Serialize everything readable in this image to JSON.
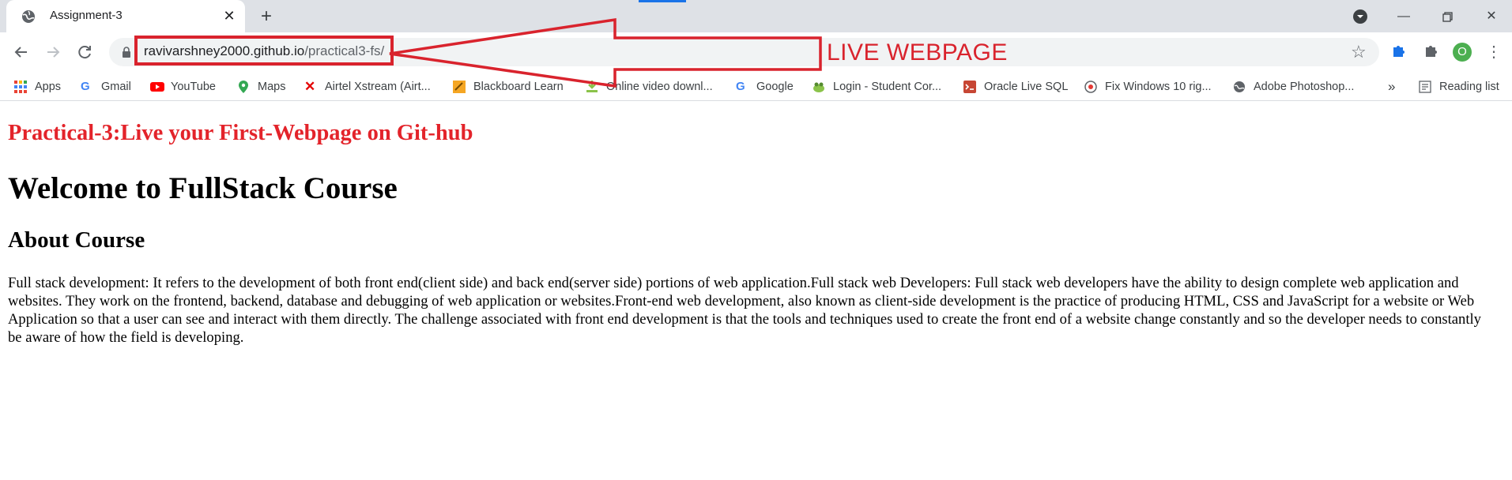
{
  "browser": {
    "tab": {
      "title": "Assignment-3",
      "favicon": "globe-icon"
    },
    "new_tab_icon": "plus-icon",
    "window_controls": [
      "profile-menu-icon",
      "minimize-icon",
      "restore-icon",
      "close-icon"
    ],
    "address": {
      "host": "ravivarshney2000.github.io",
      "path": "/practical3-fs/"
    },
    "annotation_label": "LIVE WEBPAGE",
    "extensions": [
      "puzzle-extension-icon",
      "extensions-icon"
    ],
    "profile_initial": "O",
    "bookmarks": [
      {
        "label": "Apps",
        "icon": "apps-grid-icon"
      },
      {
        "label": "Gmail",
        "icon": "google-icon"
      },
      {
        "label": "YouTube",
        "icon": "youtube-icon"
      },
      {
        "label": "Maps",
        "icon": "maps-pin-icon"
      },
      {
        "label": "Airtel Xstream (Airt...",
        "icon": "airtel-icon"
      },
      {
        "label": "Blackboard Learn",
        "icon": "blackboard-icon"
      },
      {
        "label": "Online video downl...",
        "icon": "download-icon"
      },
      {
        "label": "Google",
        "icon": "google-icon"
      },
      {
        "label": "Login - Student Cor...",
        "icon": "frog-icon"
      },
      {
        "label": "Oracle Live SQL",
        "icon": "oracle-terminal-icon"
      },
      {
        "label": "Fix Windows 10 rig...",
        "icon": "windows-fix-icon"
      },
      {
        "label": "Adobe Photoshop...",
        "icon": "globe-icon"
      }
    ],
    "bookmarks_overflow": "»",
    "reading_list": "Reading list"
  },
  "page": {
    "subtitle": "Practical-3:Live your First-Webpage on Git-hub",
    "heading": "Welcome to FullStack Course",
    "section_heading": "About Course",
    "paragraph": "Full stack development: It refers to the development of both front end(client side) and back end(server side) portions of web application.Full stack web Developers: Full stack web developers have the ability to design complete web application and websites. They work on the frontend, backend, database and debugging of web application or websites.Front-end web development, also known as client-side development is the practice of producing HTML, CSS and JavaScript for a website or Web Application so that a user can see and interact with them directly. The challenge associated with front end development is that the tools and techniques used to create the front end of a website change constantly and so the developer needs to constantly be aware of how the field is developing."
  },
  "colors": {
    "annotation_red": "#d9232d",
    "subtitle_red": "#e3232a",
    "tabstrip": "#dee1e6",
    "profile_green": "#4caf50"
  }
}
